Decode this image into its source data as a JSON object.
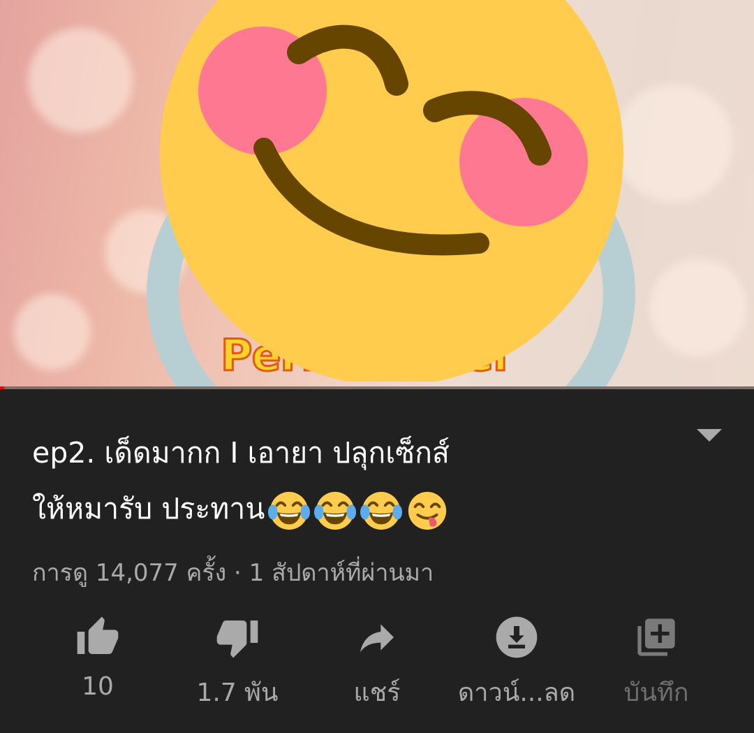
{
  "video": {
    "channel_overlay_text": "Pern   hannel"
  },
  "title": {
    "line1": "ep2. เด็ดมากก  I   เอายา ปลุกเซ็กส์",
    "line2": "ให้หมารับ ประทาน",
    "emojis": [
      "face-with-tears-of-joy",
      "face-with-tears-of-joy",
      "face-with-tears-of-joy",
      "face-savoring-food"
    ]
  },
  "meta": {
    "views_line": "การดู 14,077 ครั้ง · 1 สัปดาห์ที่ผ่านมา"
  },
  "actions": [
    {
      "id": "like",
      "icon": "thumbs-up-icon",
      "label": "10"
    },
    {
      "id": "dislike",
      "icon": "thumbs-down-icon",
      "label": "1.7 พัน"
    },
    {
      "id": "share",
      "icon": "share-arrow-icon",
      "label": "แชร์"
    },
    {
      "id": "download",
      "icon": "download-icon",
      "label": "ดาวน์...ลด"
    },
    {
      "id": "save",
      "icon": "add-to-playlist-icon",
      "label": "บันทึก",
      "disabled": true
    }
  ],
  "colors": {
    "background": "#212121",
    "text_primary": "#ffffff",
    "text_secondary": "#aaaaaa",
    "progress": "#ff0000",
    "emoji_yellow": "#ffcc4d",
    "emoji_blush": "#ff7892",
    "emoji_feature": "#664500"
  }
}
